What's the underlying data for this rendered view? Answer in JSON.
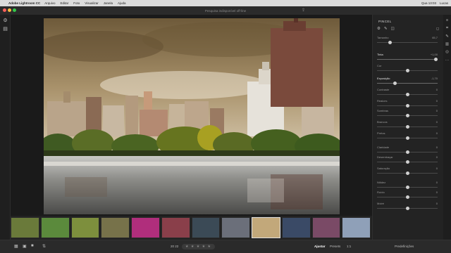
{
  "menubar": {
    "app_name": "Adobe Lightroom CC",
    "items": [
      "Arquivo",
      "Editar",
      "Foto",
      "Visualizar",
      "Janela",
      "Ajuda"
    ],
    "clock": "Qua 13:03",
    "user": "Lucas"
  },
  "window": {
    "title": "Pesquisa indisponível off-line",
    "share_icon": "share-icon"
  },
  "left_strip": {
    "icons": [
      "gear-icon",
      "library-icon"
    ]
  },
  "panel": {
    "title": "PINCEL",
    "sliders": [
      {
        "label": "Tamanho",
        "value": "65,7",
        "level": 0.22,
        "highlight": false
      },
      {
        "label": "Tinta",
        "value": "+1,00",
        "level": 0.97,
        "highlight": true
      },
      {
        "label": "Cor",
        "value": "",
        "level": 0.5,
        "highlight": false
      },
      {
        "label": "Exposição",
        "value": "-1,70",
        "level": 0.3,
        "highlight": true
      },
      {
        "label": "Contraste",
        "value": "0",
        "level": 0.5,
        "highlight": false
      },
      {
        "label": "Realces",
        "value": "0",
        "level": 0.5,
        "highlight": false
      },
      {
        "label": "Sombras",
        "value": "0",
        "level": 0.5,
        "highlight": false
      },
      {
        "label": "Brancos",
        "value": "0",
        "level": 0.5,
        "highlight": false
      },
      {
        "label": "Pretos",
        "value": "0",
        "level": 0.5,
        "highlight": false
      },
      {
        "label": "Claridade",
        "value": "0",
        "level": 0.5,
        "highlight": false
      },
      {
        "label": "Desembaçar",
        "value": "0",
        "level": 0.5,
        "highlight": false
      },
      {
        "label": "Saturação",
        "value": "0",
        "level": 0.5,
        "highlight": false
      },
      {
        "label": "Nitidez",
        "value": "0",
        "level": 0.5,
        "highlight": false
      },
      {
        "label": "Ruído",
        "value": "0",
        "level": 0.5,
        "highlight": false
      },
      {
        "label": "Moiré",
        "value": "0",
        "level": 0.5,
        "highlight": false
      }
    ]
  },
  "bottom_bar": {
    "view_icons": [
      "grid-view-icon",
      "square-grid-icon",
      "single-view-icon",
      "sort-icon"
    ],
    "count": "20 22",
    "rating": "★ ★ ★ ★ ★",
    "ajustar": "Ajustar",
    "preset": "Presets",
    "zoom": "1:1",
    "predefinicoes": "Predefinições"
  },
  "filmstrip": {
    "thumbnails": [
      {
        "color": "#6a7a3a",
        "selected": false
      },
      {
        "color": "#5b8a3c",
        "selected": false
      },
      {
        "color": "#7d8f3d",
        "selected": false
      },
      {
        "color": "#77724a",
        "selected": false
      },
      {
        "color": "#b02e7c",
        "selected": false
      },
      {
        "color": "#8a3f4a",
        "selected": false
      },
      {
        "color": "#3b4a56",
        "selected": false
      },
      {
        "color": "#6b6f7a",
        "selected": false
      },
      {
        "color": "#c2a87a",
        "selected": true
      },
      {
        "color": "#3a4a66",
        "selected": false
      },
      {
        "color": "#7a4a66",
        "selected": false
      },
      {
        "color": "#8fa0b8",
        "selected": false
      }
    ]
  },
  "colors": {
    "traffic_red": "#fc605b",
    "traffic_yellow": "#fdbc40",
    "traffic_green": "#34c84a"
  }
}
